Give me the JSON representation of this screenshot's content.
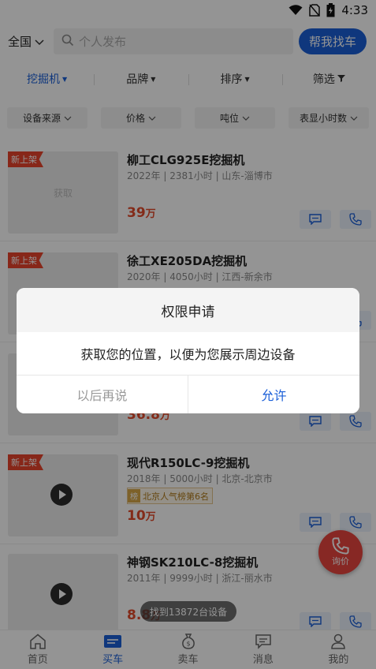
{
  "status_bar": {
    "time": "4:33"
  },
  "header": {
    "region": "全国",
    "search_placeholder": "个人发布",
    "help_button": "帮我找车"
  },
  "filter_tabs": [
    {
      "label": "挖掘机",
      "active": true
    },
    {
      "label": "品牌",
      "active": false
    },
    {
      "label": "排序",
      "active": false
    },
    {
      "label": "筛选",
      "active": false
    }
  ],
  "chips": [
    "设备来源",
    "价格",
    "吨位",
    "表显小时数"
  ],
  "listings": [
    {
      "badge": "新上架",
      "placeholder": "获取",
      "title": "柳工CLG925E挖掘机",
      "meta": "2022年 | 2381小时 | 山东-淄博市",
      "price": "39",
      "unit": "万",
      "rank": "",
      "video": false
    },
    {
      "badge": "新上架",
      "placeholder": "",
      "title": "徐工XE205DA挖掘机",
      "meta": "2020年 | 4050小时 | 江西-新余市",
      "price": "",
      "unit": "",
      "rank": "",
      "video": false
    },
    {
      "badge": "",
      "placeholder": "",
      "title": "",
      "meta": "",
      "price": "36.8",
      "unit": "万",
      "rank": "",
      "video": false
    },
    {
      "badge": "新上架",
      "placeholder": "",
      "title": "现代R150LC-9挖掘机",
      "meta": "2018年 | 5000小时 | 北京-北京市",
      "price": "10",
      "unit": "万",
      "rank": "北京人气榜第6名",
      "video": true
    },
    {
      "badge": "",
      "placeholder": "",
      "title": "神钢SK210LC-8挖掘机",
      "meta": "2011年 | 9999小时 | 浙江-丽水市",
      "price": "8.8",
      "unit": "万",
      "rank": "",
      "video": true
    }
  ],
  "rank_icon_char": "榜",
  "fab_label": "询价",
  "toast": "找到13872台设备",
  "tabbar": [
    {
      "label": "首页",
      "icon": "home-icon",
      "active": false
    },
    {
      "label": "买车",
      "icon": "buy-icon",
      "active": true
    },
    {
      "label": "卖车",
      "icon": "sell-icon",
      "active": false
    },
    {
      "label": "消息",
      "icon": "message-icon",
      "active": false
    },
    {
      "label": "我的",
      "icon": "profile-icon",
      "active": false
    }
  ],
  "dialog": {
    "title": "权限申请",
    "message": "获取您的位置，以便为您展示周边设备",
    "cancel": "以后再说",
    "confirm": "允许"
  },
  "colors": {
    "accent": "#1a5fd8",
    "price": "#e24a2b",
    "badge": "#e8442c"
  }
}
